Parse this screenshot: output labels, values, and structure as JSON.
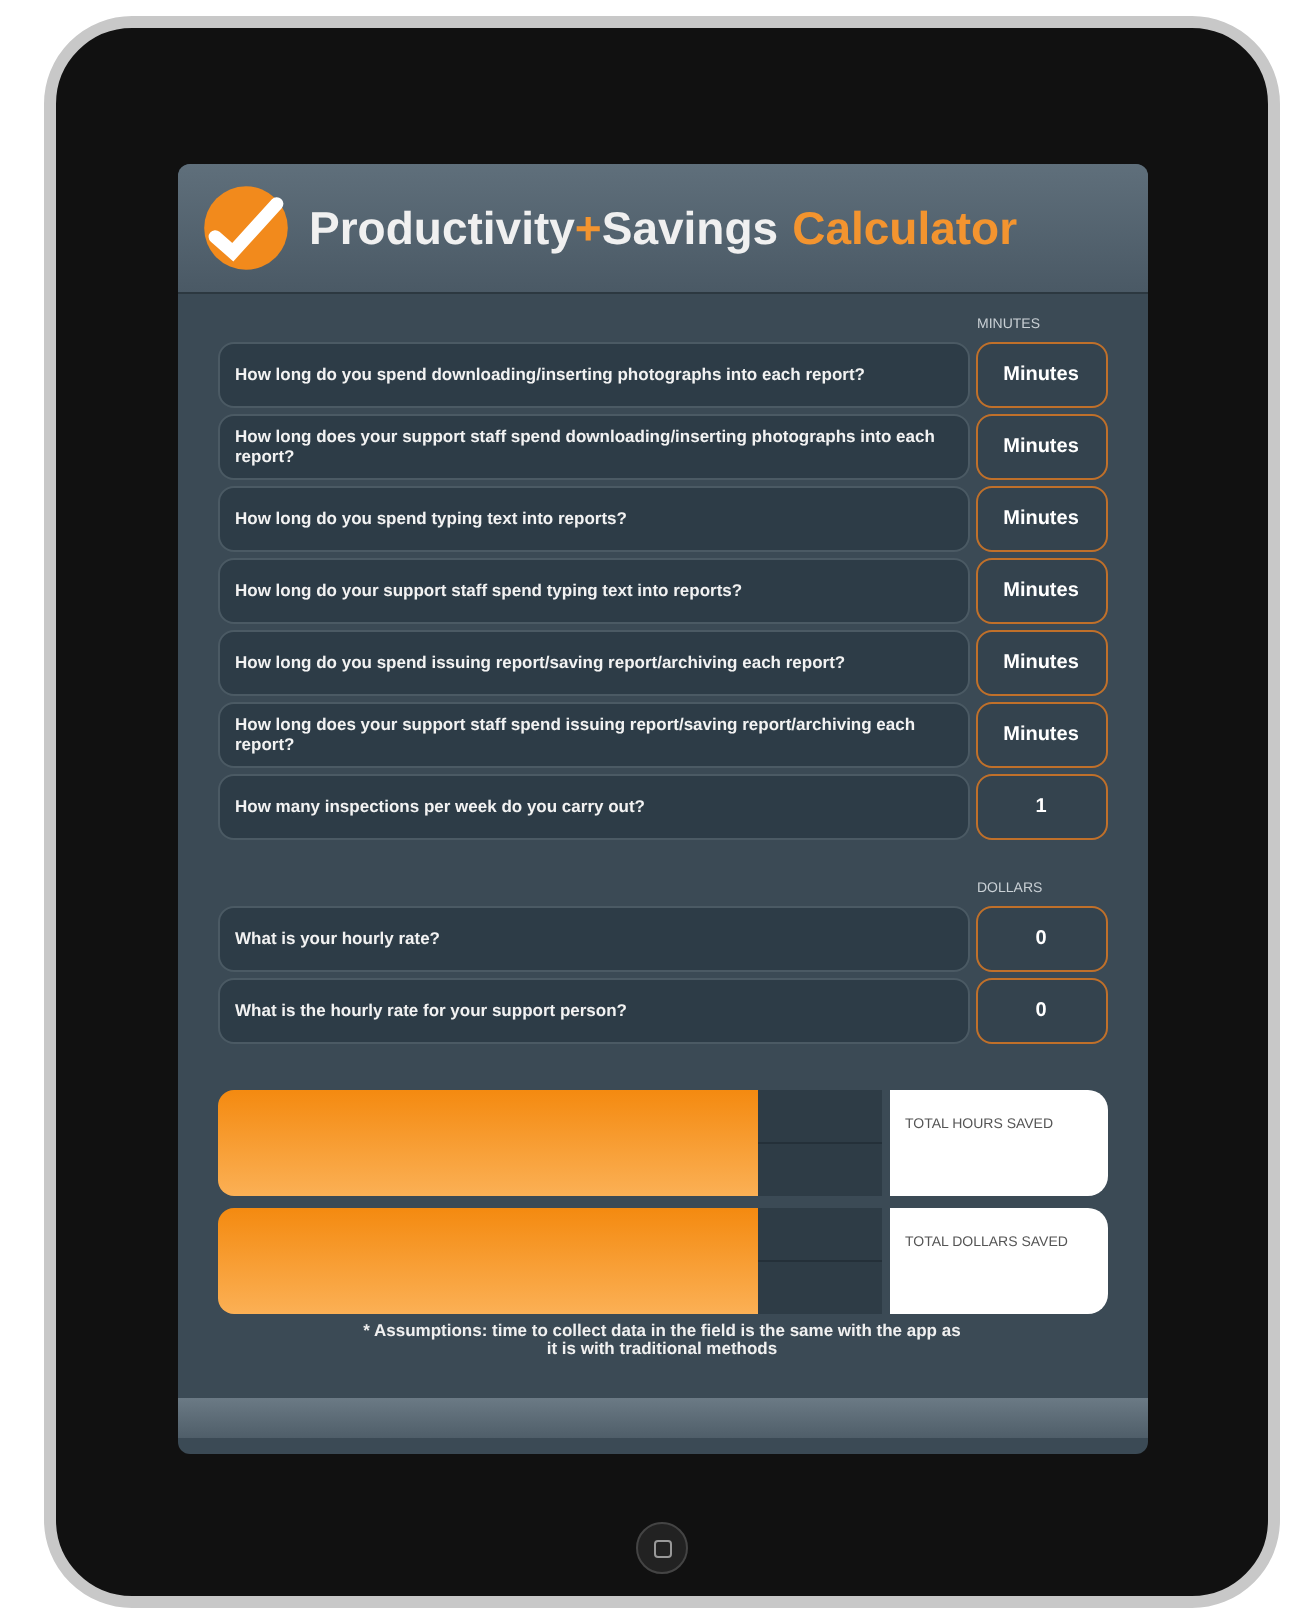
{
  "title": {
    "parts": [
      {
        "text": "Productivity",
        "kind": "light"
      },
      {
        "text": "+",
        "kind": "accent"
      },
      {
        "text": "Savings",
        "kind": "light"
      },
      {
        "text": "Calculator",
        "kind": "accent"
      }
    ]
  },
  "sections": [
    {
      "heading": "MINUTES",
      "questions": [
        {
          "label": "How long do you spend downloading/inserting photographs into each report?",
          "placeholder": "Minutes"
        },
        {
          "label": "How long does your support staff spend downloading/inserting photographs into each report?",
          "placeholder": "Minutes"
        },
        {
          "label": "How long do you spend typing text into reports?",
          "placeholder": "Minutes"
        },
        {
          "label": "How long do your support staff spend typing text into reports?",
          "placeholder": "Minutes"
        },
        {
          "label": "How long do you spend issuing report/saving report/archiving each report?",
          "placeholder": "Minutes"
        },
        {
          "label": "How long does your support staff spend issuing report/saving report/archiving each report?",
          "placeholder": "Minutes"
        },
        {
          "label": "How many inspections per week do you carry out?",
          "value": "1"
        }
      ]
    },
    {
      "heading": "DOLLARS",
      "questions": [
        {
          "label": "What is your hourly rate?",
          "value": "0"
        },
        {
          "label": "What is the hourly rate for your support person?",
          "value": "0"
        }
      ]
    }
  ],
  "results": [
    {
      "label": "TOTAL HOURS SAVED"
    },
    {
      "label": "TOTAL DOLLARS SAVED"
    }
  ],
  "footnote": "* Assumptions: time to collect data in the field is the same with the app as it is with traditional methods"
}
